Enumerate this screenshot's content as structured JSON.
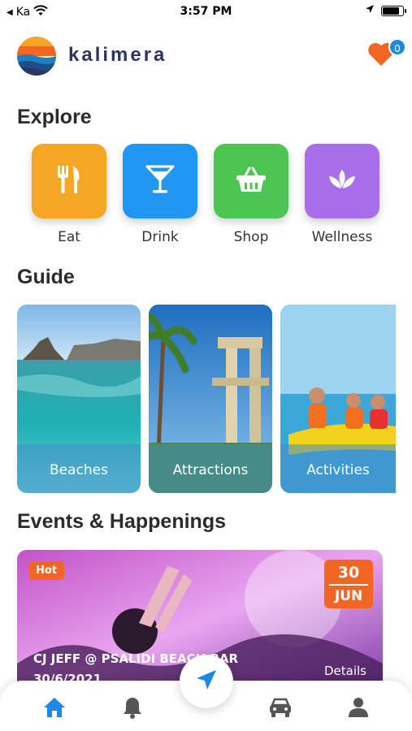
{
  "status_bar": {
    "carrier": "Ka",
    "time": "3:57 PM"
  },
  "header": {
    "app_name": "kalimera",
    "favorites_count": "0",
    "favorites_icon": "heart-icon",
    "accent_color": "#f26522"
  },
  "explore": {
    "title": "Explore",
    "items": [
      {
        "label": "Eat",
        "icon": "cutlery-icon",
        "color": "#f5a623"
      },
      {
        "label": "Drink",
        "icon": "cocktail-icon",
        "color": "#2196f3"
      },
      {
        "label": "Shop",
        "icon": "basket-icon",
        "color": "#4cc552"
      },
      {
        "label": "Wellness",
        "icon": "lotus-icon",
        "color": "#a86de8"
      }
    ]
  },
  "guide": {
    "title": "Guide",
    "items": [
      {
        "label": "Beaches"
      },
      {
        "label": "Attractions"
      },
      {
        "label": "Activities"
      }
    ]
  },
  "events": {
    "title": "Events & Happenings",
    "card": {
      "badge": "Hot",
      "day": "30",
      "month": "JUN",
      "title": "CJ JEFF @ PSALIDI BEACH BAR",
      "date_text": "30/6/2021",
      "details_label": "Details"
    }
  },
  "bottom_nav": {
    "items": [
      "home-icon",
      "bell-icon",
      "navigation-arrow-icon",
      "car-icon",
      "user-icon"
    ],
    "active_color": "#1e88e5"
  }
}
